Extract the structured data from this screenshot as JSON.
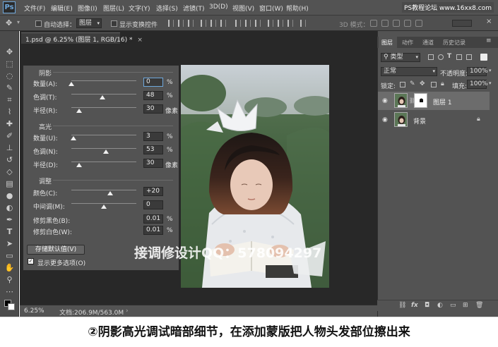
{
  "app": {
    "logo": "Ps",
    "menu": [
      "文件(F)",
      "编辑(E)",
      "图像(I)",
      "图层(L)",
      "文字(Y)",
      "选择(S)",
      "滤镜(T)",
      "3D(D)",
      "视图(V)",
      "窗口(W)",
      "帮助(H)"
    ],
    "watermark": "PS教程论坛 www.16xx8.com"
  },
  "options_bar": {
    "auto_select_label": "自动选择：",
    "auto_select_value": "图层",
    "show_transform_label": "显示变换控件",
    "mode_3d_label": "3D 模式："
  },
  "document": {
    "tab_title": "1.psd @ 6.25% (图层 1, RGB/16) *",
    "overlay_text": "接调修设计QQ：578094297"
  },
  "dialog": {
    "shadows": {
      "title": "阴影",
      "rows": [
        {
          "label": "数量(A):",
          "value": "0",
          "unit": "%",
          "level": 0
        },
        {
          "label": "色调(T):",
          "value": "48",
          "unit": "%",
          "level": 0.48
        },
        {
          "label": "半径(R):",
          "value": "30",
          "unit": "像素",
          "level": 0.12
        }
      ]
    },
    "highlights": {
      "title": "高光",
      "rows": [
        {
          "label": "数量(U):",
          "value": "3",
          "unit": "%",
          "level": 0.03
        },
        {
          "label": "色调(N):",
          "value": "53",
          "unit": "%",
          "level": 0.53
        },
        {
          "label": "半径(D):",
          "value": "30",
          "unit": "像素",
          "level": 0.12
        }
      ]
    },
    "adjust": {
      "title": "调整",
      "rows": [
        {
          "label": "颜色(C):",
          "value": "+20",
          "unit": "",
          "level": 0.6
        },
        {
          "label": "中间调(M):",
          "value": "0",
          "unit": "",
          "level": 0.5
        },
        {
          "label": "修剪黑色(B):",
          "value": "0.01",
          "unit": "%",
          "level": null
        },
        {
          "label": "修剪白色(W):",
          "value": "0.01",
          "unit": "%",
          "level": null
        }
      ]
    },
    "save_defaults": "存储默认值(V)",
    "more_options": "显示更多选项(O)"
  },
  "status": {
    "zoom": "6.25%",
    "doc_size": "文档:206.9M/563.0M"
  },
  "panel": {
    "tabs": [
      "图层",
      "动作",
      "通道",
      "历史记录"
    ],
    "kind_label": "类型",
    "blend_mode": "正常",
    "opacity_label": "不透明度:",
    "opacity_value": "100%",
    "lock_label": "锁定:",
    "fill_label": "填充:",
    "fill_value": "100%",
    "layers": [
      {
        "name": "图层 1",
        "selected": true,
        "has_mask": true
      },
      {
        "name": "背景",
        "selected": false,
        "locked": true
      }
    ]
  },
  "caption": "②阴影高光调试暗部细节，在添加蒙版把人物头发部位擦出来",
  "colors": {
    "ps_blue": "#6fa8dc",
    "ui_dark": "#535353",
    "canvas_bg": "#282828"
  }
}
